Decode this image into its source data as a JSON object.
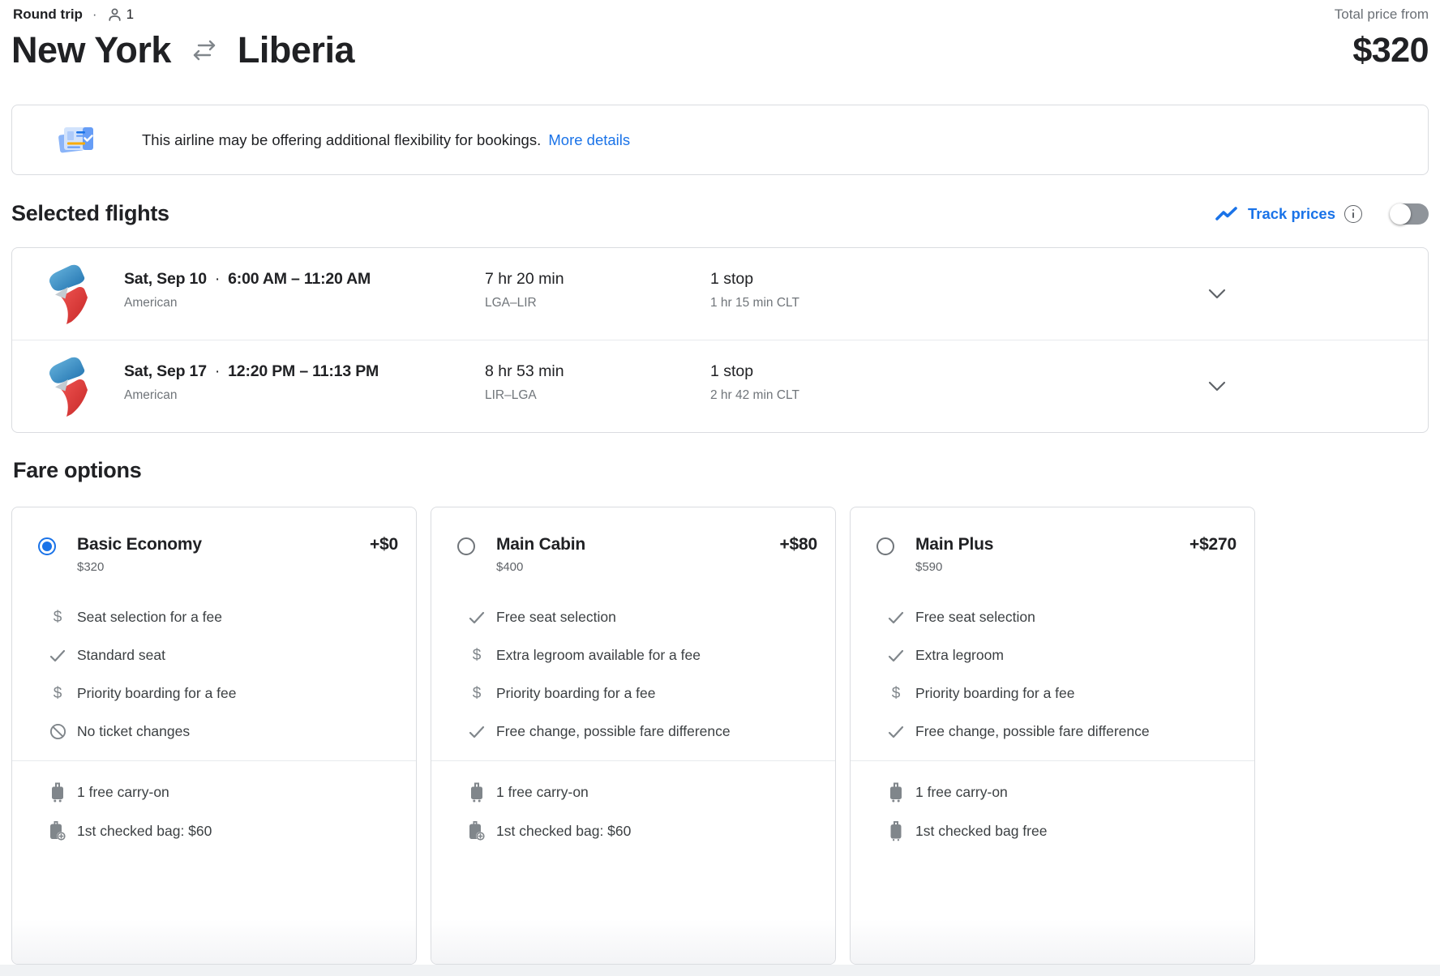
{
  "header": {
    "trip_type": "Round trip",
    "separator": "·",
    "passenger_count": "1",
    "origin": "New York",
    "destination": "Liberia",
    "total_price_label": "Total price from",
    "total_price": "$320"
  },
  "banner": {
    "message": "This airline may be offering additional flexibility for bookings.",
    "link_label": "More details"
  },
  "selected_flights": {
    "title": "Selected flights",
    "track_prices_label": "Track prices",
    "track_prices_enabled": false,
    "flights": [
      {
        "date": "Sat, Sep 10",
        "separator": "·",
        "times": "6:00 AM – 11:20 AM",
        "airline": "American",
        "duration": "7 hr 20 min",
        "route": "LGA–LIR",
        "stops": "1 stop",
        "stop_detail": "1 hr 15 min CLT"
      },
      {
        "date": "Sat, Sep 17",
        "separator": "·",
        "times": "12:20 PM – 11:13 PM",
        "airline": "American",
        "duration": "8 hr 53 min",
        "route": "LIR–LGA",
        "stops": "1 stop",
        "stop_detail": "2 hr 42 min CLT"
      }
    ]
  },
  "fare_options": {
    "title": "Fare options",
    "cards": [
      {
        "name": "Basic Economy",
        "price": "$320",
        "delta": "+$0",
        "selected": true,
        "features": [
          {
            "icon": "dollar-icon",
            "text": "Seat selection for a fee"
          },
          {
            "icon": "check-icon",
            "text": "Standard seat"
          },
          {
            "icon": "dollar-icon",
            "text": "Priority boarding for a fee"
          },
          {
            "icon": "block-icon",
            "text": "No ticket changes"
          }
        ],
        "baggage": [
          {
            "icon": "carry-on-bag-icon",
            "text": "1 free carry-on"
          },
          {
            "icon": "checked-bag-add-icon",
            "text": "1st checked bag: $60"
          }
        ]
      },
      {
        "name": "Main Cabin",
        "price": "$400",
        "delta": "+$80",
        "selected": false,
        "features": [
          {
            "icon": "check-icon",
            "text": "Free seat selection"
          },
          {
            "icon": "dollar-icon",
            "text": "Extra legroom available for a fee"
          },
          {
            "icon": "dollar-icon",
            "text": "Priority boarding for a fee"
          },
          {
            "icon": "check-icon",
            "text": "Free change, possible fare difference"
          }
        ],
        "baggage": [
          {
            "icon": "carry-on-bag-icon",
            "text": "1 free carry-on"
          },
          {
            "icon": "checked-bag-add-icon",
            "text": "1st checked bag: $60"
          }
        ]
      },
      {
        "name": "Main Plus",
        "price": "$590",
        "delta": "+$270",
        "selected": false,
        "features": [
          {
            "icon": "check-icon",
            "text": "Free seat selection"
          },
          {
            "icon": "check-icon",
            "text": "Extra legroom"
          },
          {
            "icon": "dollar-icon",
            "text": "Priority boarding for a fee"
          },
          {
            "icon": "check-icon",
            "text": "Free change, possible fare difference"
          }
        ],
        "baggage": [
          {
            "icon": "carry-on-bag-icon",
            "text": "1 free carry-on"
          },
          {
            "icon": "checked-bag-icon",
            "text": "1st checked bag free"
          }
        ]
      }
    ]
  },
  "colors": {
    "accent_blue": "#1a73e8",
    "text_primary": "#202124",
    "text_secondary": "#5f6368",
    "border": "#dadce0",
    "aa_blue": "#1d6fad",
    "aa_red": "#c62828"
  }
}
